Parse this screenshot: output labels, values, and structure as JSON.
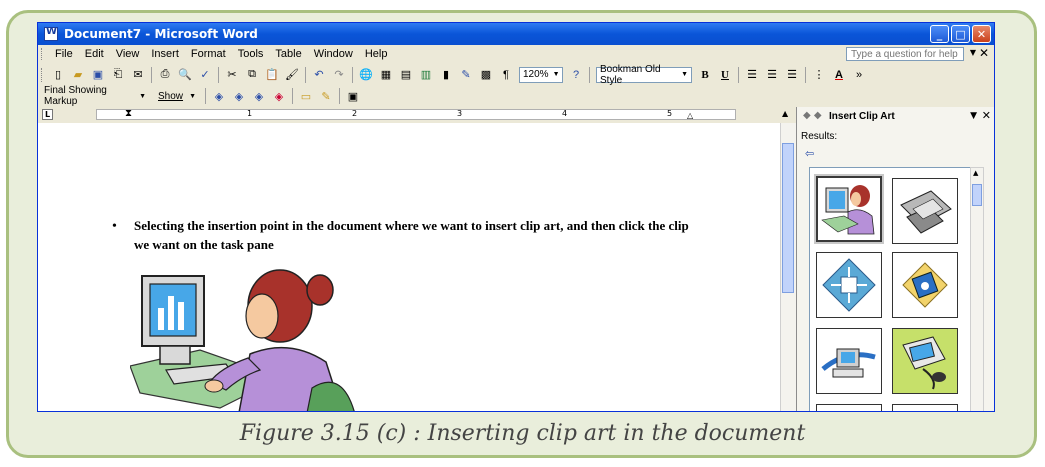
{
  "window": {
    "title": "Document7 - Microsoft Word",
    "controls": [
      "_",
      "□",
      "✕"
    ]
  },
  "menubar": {
    "items": [
      "File",
      "Edit",
      "View",
      "Insert",
      "Format",
      "Tools",
      "Table",
      "Window",
      "Help"
    ],
    "help_placeholder": "Type a question for help"
  },
  "toolbar": {
    "zoom": "120%",
    "font": "Bookman Old Style",
    "bold": "B",
    "underline": "U"
  },
  "toolbar2": {
    "markup": "Final Showing Markup",
    "show": "Show"
  },
  "ruler": {
    "numbers": [
      "1",
      "2",
      "3",
      "4",
      "5"
    ]
  },
  "document": {
    "bullet_text": "Selecting the insertion point in the document where we want to insert clip art, and then click the clip we want on the task pane"
  },
  "task_pane": {
    "title": "Insert Clip Art",
    "results_label": "Results:"
  },
  "caption": "Figure 3.15 (c) : Inserting clip art in the document"
}
